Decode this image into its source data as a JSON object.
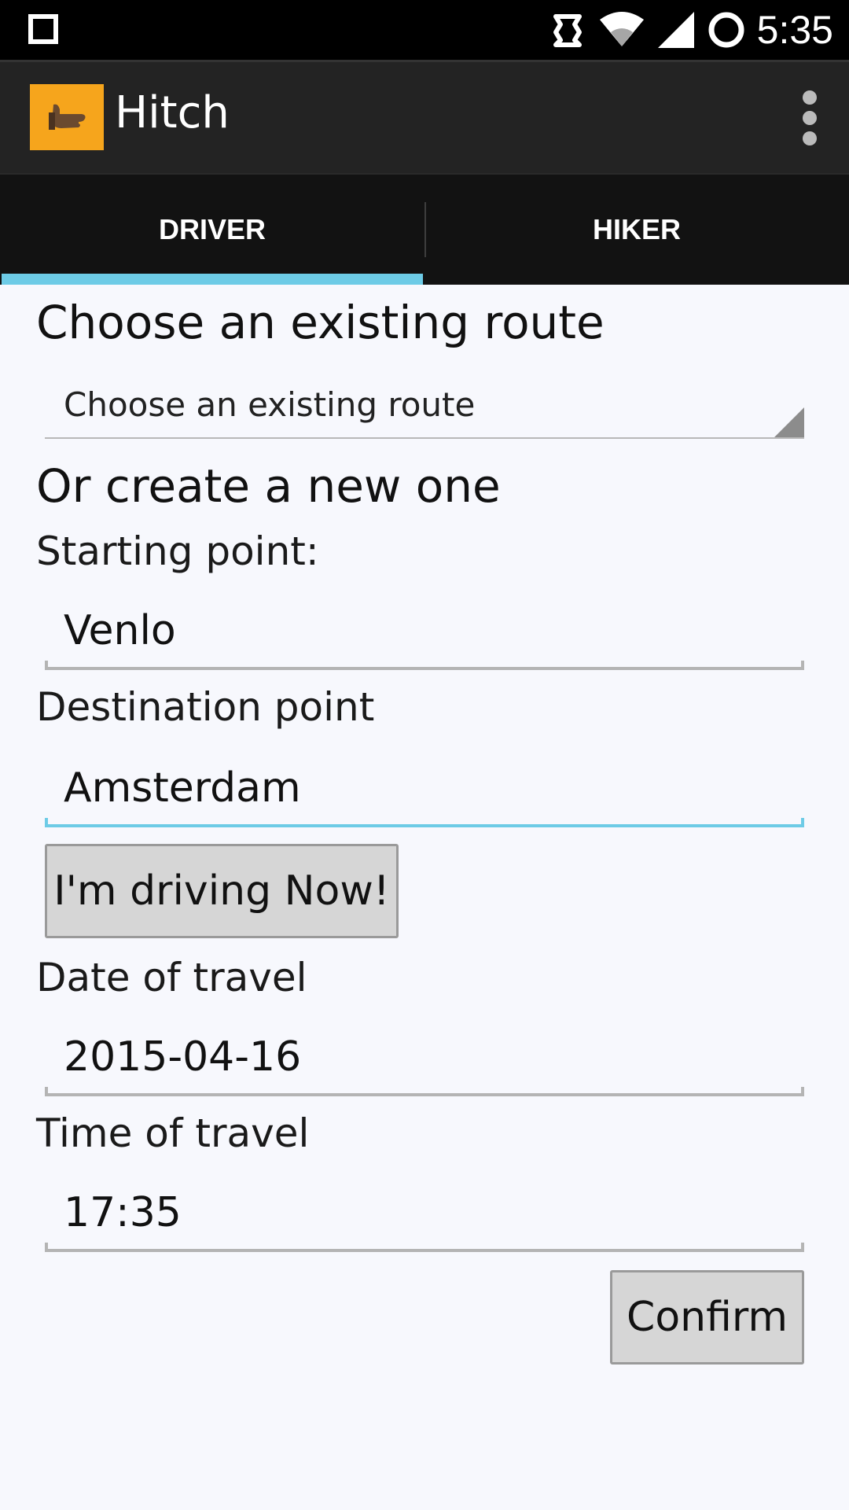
{
  "status_bar": {
    "time": "5:35",
    "icons": [
      "square-icon",
      "vibrate-icon",
      "wifi-icon",
      "signal-icon",
      "sync-circle-icon"
    ]
  },
  "app": {
    "title": "Hitch",
    "icon": "thumbs-up-hitch-icon",
    "icon_color": "#f6a51c"
  },
  "tabs": [
    {
      "label": "DRIVER",
      "active": true
    },
    {
      "label": "HIKER",
      "active": false
    }
  ],
  "accent_color": "#6dcbe6",
  "form": {
    "existing_heading": "Choose an existing route",
    "existing_spinner": "Choose an existing route",
    "new_heading": "Or create a new one",
    "start_label": "Starting point:",
    "start_value": "Venlo",
    "dest_label": "Destination point",
    "dest_value": "Amsterdam",
    "drive_now_button": "I'm driving Now!",
    "date_label": "Date of travel",
    "date_value": "2015-04-16",
    "time_label": "Time of travel",
    "time_value": "17:35",
    "confirm_button": "Confirm"
  }
}
